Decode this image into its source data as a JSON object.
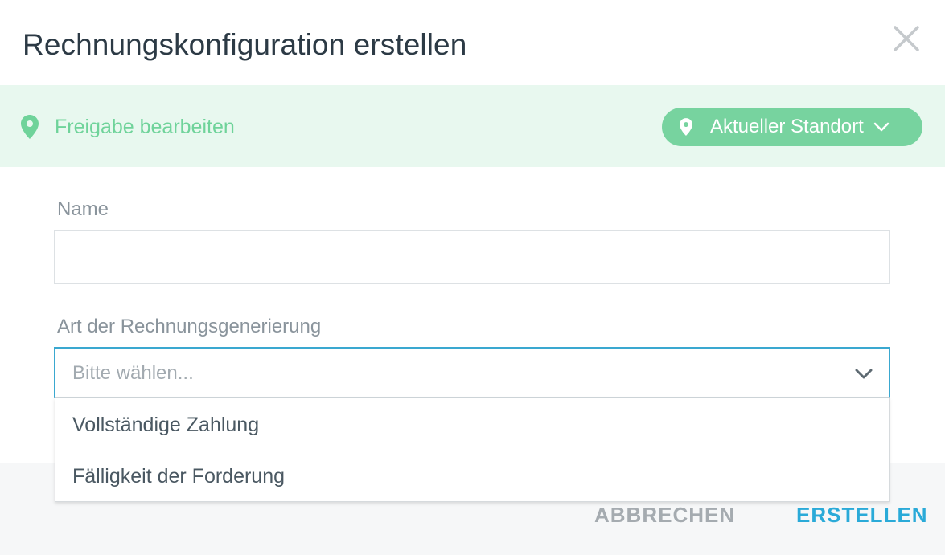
{
  "dialog": {
    "title": "Rechnungskonfiguration erstellen"
  },
  "share_bar": {
    "label": "Freigabe bearbeiten",
    "location_button": "Aktueller Standort",
    "accent_color": "#6fd39a",
    "background_color": "#e8f8ef"
  },
  "form": {
    "name": {
      "label": "Name",
      "value": "",
      "placeholder": ""
    },
    "generation_type": {
      "label": "Art der Rechnungsgenerierung",
      "placeholder": "Bitte wählen...",
      "options": [
        "Vollständige Zahlung",
        "Fälligkeit der Forderung"
      ]
    }
  },
  "footer": {
    "cancel_label": "ABBRECHEN",
    "create_label": "ERSTELLEN",
    "primary_color": "#2aaad8"
  },
  "icons": {
    "close": "close-icon",
    "share_pin": "map-pin-icon",
    "location_pin": "map-pin-icon",
    "location_chevron": "chevron-down-icon",
    "select_chevron": "chevron-down-icon"
  }
}
